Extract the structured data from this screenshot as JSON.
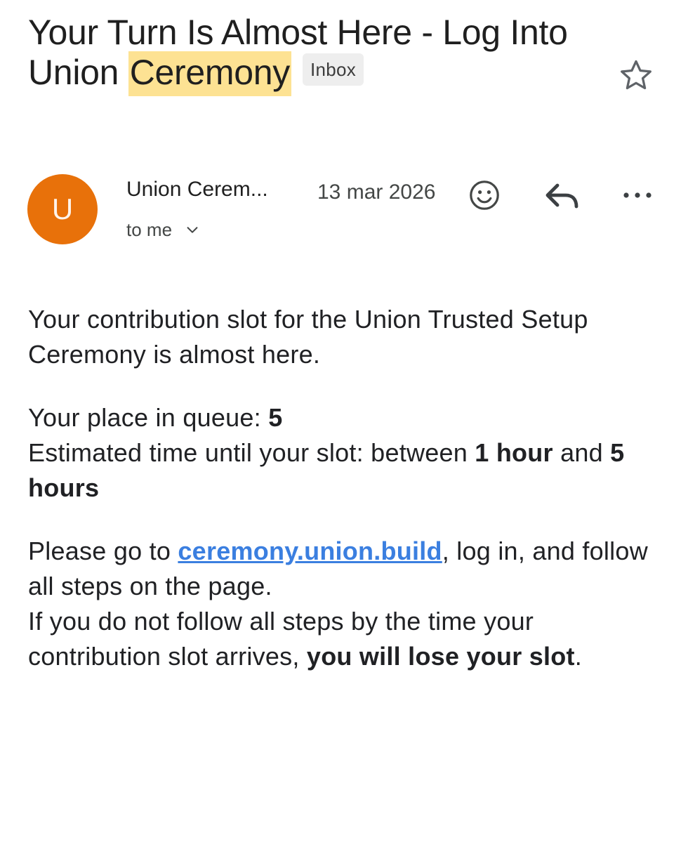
{
  "email": {
    "subject_part1": "Your Turn Is Almost Here - Log Into Union ",
    "subject_highlight": "Ceremony",
    "label_chip": "Inbox",
    "sender": {
      "initial": "U",
      "name": "Union Cerem...",
      "date": "13 mar 2026",
      "recipient": "to me",
      "avatar_color": "#e8710a"
    },
    "icons": {
      "star": "star-outline-icon",
      "emoji": "emoji-reaction-icon",
      "reply": "reply-icon",
      "more": "more-options-icon",
      "recipient_toggle": "chevron-down-icon"
    },
    "body": {
      "p1": "Your contribution slot for the Union Trusted Setup Ceremony is almost here.",
      "queue_label": "Your place in queue: ",
      "queue_value": "5",
      "eta_label": "Estimated time until your slot: between ",
      "eta_min": "1 hour",
      "eta_and": " and ",
      "eta_max": "5 hours",
      "cta_prefix": "Please go to ",
      "cta_link": "ceremony.union.build",
      "cta_suffix": ", log in, and follow all steps on the page.",
      "warning_prefix": "If you do not follow all steps by the time your contribution slot arrives, ",
      "warning_bold": "you will lose your slot",
      "warning_suffix": "."
    }
  },
  "colors": {
    "highlight": "#fde293",
    "link": "#3b7fe0",
    "chip_background": "#eeeeee"
  }
}
